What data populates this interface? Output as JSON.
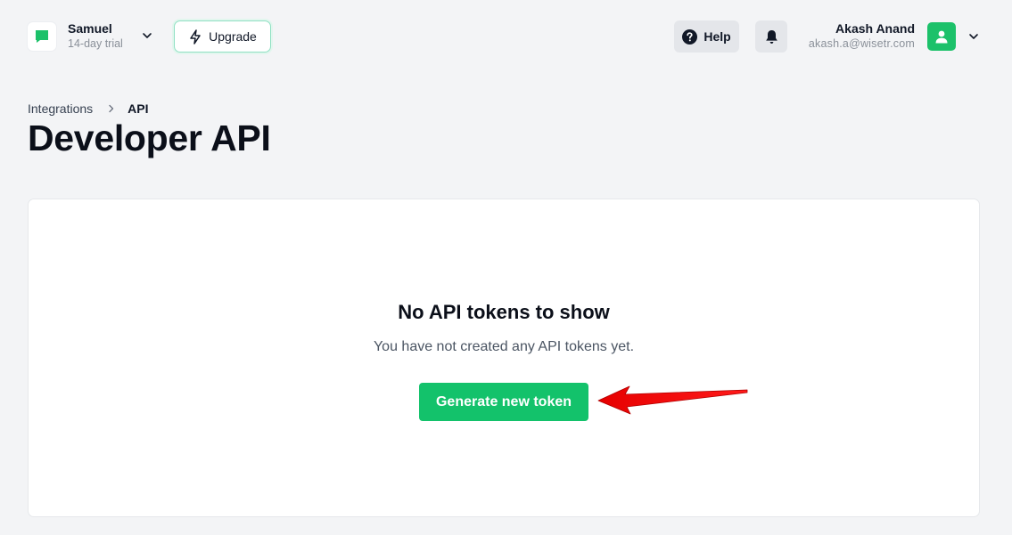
{
  "workspace": {
    "name": "Samuel",
    "plan": "14-day trial",
    "logo_icon": "chat-bubble-icon",
    "accent": "#1cc16a"
  },
  "toolbar": {
    "upgrade_label": "Upgrade",
    "upgrade_icon": "lightning-bolt-icon",
    "help_label": "Help",
    "help_icon": "question-circle-icon",
    "notifications_icon": "bell-icon"
  },
  "user": {
    "name": "Akash Anand",
    "email": "akash.a@wisetr.com",
    "avatar_icon": "user-icon",
    "avatar_color": "#1cc16a"
  },
  "breadcrumb": {
    "parent": "Integrations",
    "current": "API"
  },
  "page": {
    "title": "Developer API"
  },
  "empty_state": {
    "title": "No API tokens to show",
    "description": "You have not created any API tokens yet.",
    "button_label": "Generate new token",
    "button_color": "#13c26b"
  },
  "annotation": {
    "type": "red-arrow",
    "color": "#ff0000"
  }
}
